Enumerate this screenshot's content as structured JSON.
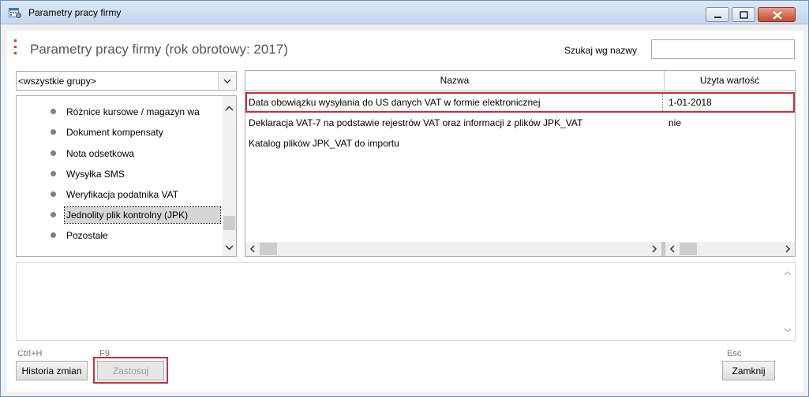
{
  "window": {
    "title": "Parametry pracy firmy",
    "icon": "calendar-settings-icon"
  },
  "header": {
    "title": "Parametry pracy firmy (rok obrotowy: 2017)",
    "search_label": "Szukaj wg nazwy",
    "search_value": "",
    "search_placeholder": ""
  },
  "group_select": {
    "selected": "<wszystkie grupy>"
  },
  "tree": {
    "items": [
      {
        "label": "Różnice kursowe / magazyn wa",
        "selected": false
      },
      {
        "label": "Dokument kompensaty",
        "selected": false
      },
      {
        "label": "Nota odsetkowa",
        "selected": false
      },
      {
        "label": "Wysyłka SMS",
        "selected": false
      },
      {
        "label": "Weryfikacja podatnika VAT",
        "selected": false
      },
      {
        "label": "Jednolity plik kontrolny (JPK)",
        "selected": true
      },
      {
        "label": "Pozostałe",
        "selected": false
      }
    ]
  },
  "grid": {
    "columns": {
      "name": "Nazwa",
      "value": "Użyta wartość"
    },
    "rows": [
      {
        "name": "Data obowiązku wysyłania do US danych VAT w formie elektronicznej",
        "value": "1-01-2018",
        "highlighted": true
      },
      {
        "name": "Deklaracja VAT-7 na podstawie rejestrów VAT oraz informacji z plików JPK_VAT",
        "value": "nie",
        "highlighted": false
      },
      {
        "name": "Katalog plików JPK_VAT do importu",
        "value": "",
        "highlighted": false
      }
    ]
  },
  "footer": {
    "history": {
      "shortcut": "Ctrl+H",
      "label": "Historia zmian"
    },
    "apply": {
      "shortcut": "F9",
      "label": "Zastosuj",
      "enabled": false
    },
    "close": {
      "shortcut": "Esc",
      "label": "Zamknij"
    }
  },
  "colors": {
    "highlight_outline": "#c8303a",
    "accent_dots": "#d83a2a",
    "title_bar": "#c5d7ee"
  }
}
